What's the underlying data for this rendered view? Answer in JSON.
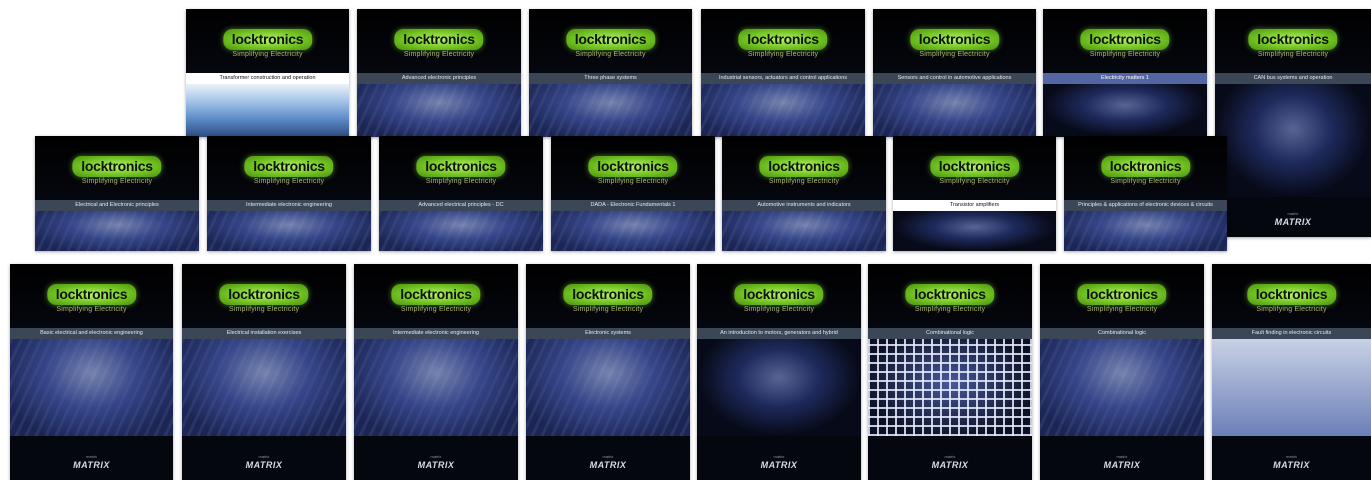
{
  "logo_text": "locktronics",
  "tagline": "Simplifying Electricity",
  "publisher_small": "matrix",
  "publisher_logo": "MATRIX",
  "row1": [
    {
      "title": "Transformer construction and operation",
      "style": "sky"
    },
    {
      "title": "Advanced electronic principles",
      "style": "photo"
    },
    {
      "title": "Three phase systems",
      "style": "photo"
    },
    {
      "title": "Industrial sensors, actuators and control applications",
      "style": "photo"
    },
    {
      "title": "Sensors and control in automotive applications",
      "style": "photo"
    },
    {
      "title": "Electricity matters 1",
      "style": "dark"
    },
    {
      "title": "CAN bus systems and operation",
      "style": "photo"
    }
  ],
  "row2": [
    {
      "title": "Electrical and Electronic principles",
      "style": "photo"
    },
    {
      "title": "Intermediate electronic engineering",
      "style": "photo"
    },
    {
      "title": "Advanced electrical principles - DC",
      "style": "photo"
    },
    {
      "title": "DADA - Electronic Fundamentals 1",
      "style": "photo"
    },
    {
      "title": "Automotive instruments and indicators",
      "style": "photo"
    },
    {
      "title": "Transistor amplifiers",
      "style": "photo"
    },
    {
      "title": "Principles & applications of electronic devices & circuits",
      "style": "photo"
    }
  ],
  "row3": [
    {
      "title": "Basic electrical and electronic engineering",
      "style": "photo"
    },
    {
      "title": "Electrical installation exercises",
      "style": "photo"
    },
    {
      "title": "Intermediate electronic engineering",
      "style": "photo"
    },
    {
      "title": "Electronic systems",
      "style": "photo"
    },
    {
      "title": "An introduction to motors, generators and hybrid",
      "style": "photo"
    },
    {
      "title": "Combinational logic",
      "style": "grid"
    },
    {
      "title": "Combinational logic",
      "style": "photo"
    },
    {
      "title": "Fault finding in electronic circuits",
      "style": "photo"
    }
  ]
}
